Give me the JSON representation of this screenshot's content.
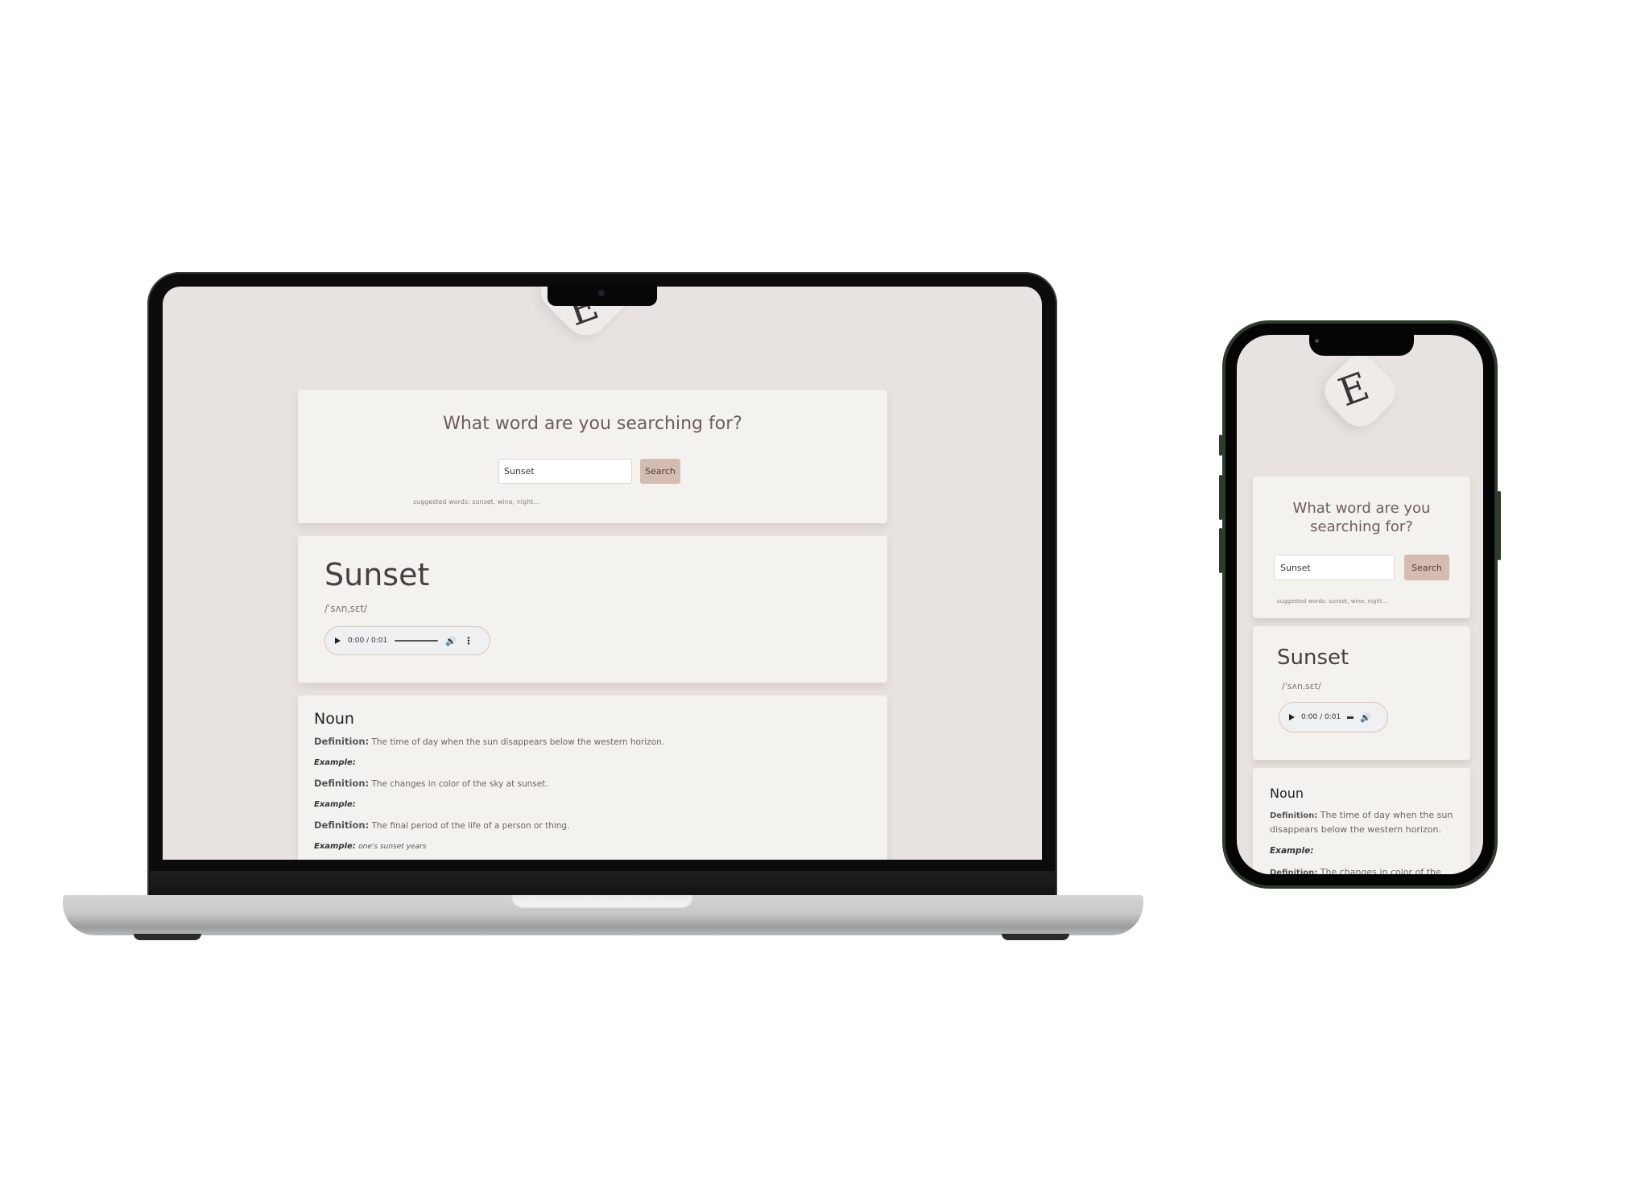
{
  "app": {
    "prompt": "What word are you searching for?",
    "search": {
      "value": "Sunset",
      "button_label": "Search"
    },
    "suggestions": "suggested words: sunset, wine, night...",
    "logo_icon": "E"
  },
  "entry": {
    "word": "Sunset",
    "phonetic": "/ˈsʌnˌsɛt/",
    "audio": {
      "time": "0:00 / 0:01",
      "progress": 0
    }
  },
  "meanings": {
    "part_of_speech": "Noun",
    "definition_label": "Definition:",
    "example_label": "Example:",
    "items": [
      {
        "definition": "The time of day when the sun disappears below the western horizon.",
        "example": ""
      },
      {
        "definition": "The changes in color of the sky at sunset.",
        "example": ""
      },
      {
        "definition": "The final period of the life of a person or thing.",
        "example": "one's sunset years"
      }
    ],
    "phone_items": [
      {
        "definition": "The time of day when the sun disappears below the western horizon."
      },
      {
        "definition": "The changes in color of the"
      }
    ]
  },
  "icons": {
    "play": "play-icon",
    "volume": "volume-icon",
    "more": "more-vert-icon",
    "logo": "letter-e-logo"
  }
}
